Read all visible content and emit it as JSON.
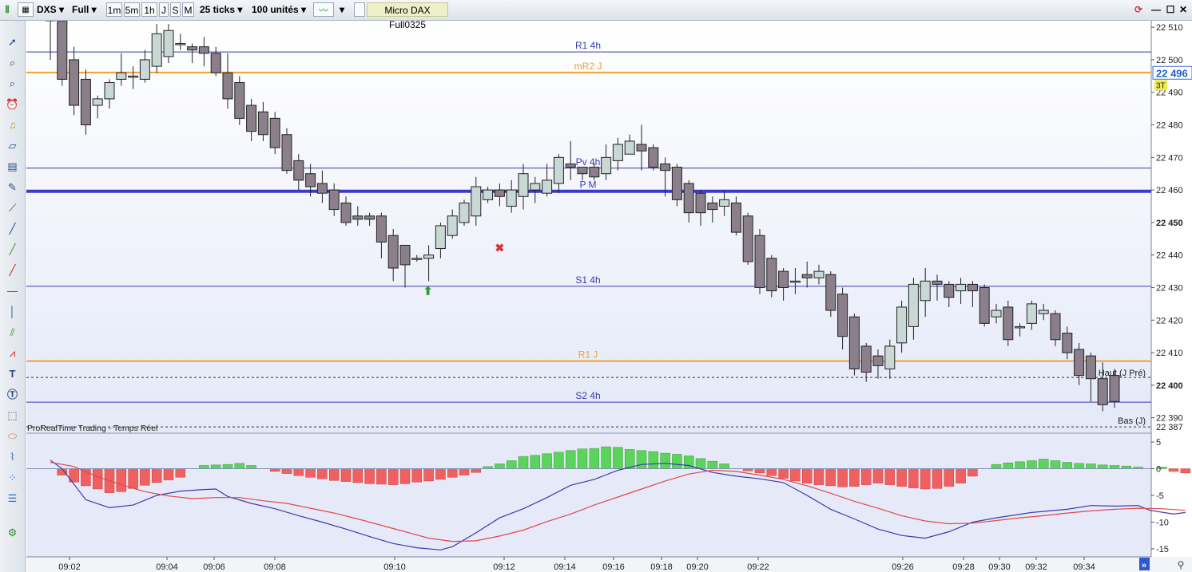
{
  "toolbar": {
    "instrument": "DXS",
    "range": "Full",
    "periods": [
      "1m",
      "5m",
      "1h",
      "J",
      "S",
      "M"
    ],
    "ticks": "25 ticks",
    "units": "100 unités",
    "contract": "Micro DAX Full0325"
  },
  "chart_title": "ProRealTime Trading - Temps Réel",
  "chart_data": [
    {
      "type": "candlestick",
      "y_ticks": [
        22510,
        22500,
        22490,
        22480,
        22470,
        22460,
        22450,
        22440,
        22430,
        22420,
        22410,
        22400,
        22390
      ],
      "ylim": [
        22385.5,
        22512
      ],
      "bold_ticks": [
        22450,
        22400
      ],
      "x_ticks": [
        "09:02",
        "09:04",
        "09:06",
        "09:08",
        "09:10",
        "09:12",
        "09:14",
        "09:16",
        "09:18",
        "09:20",
        "09:22",
        "09:26",
        "09:28",
        "09:30",
        "09:32",
        "09:34"
      ],
      "current_price": "22 496",
      "current_badge": "3T",
      "price_labels": [
        "22 387"
      ],
      "levels": [
        {
          "label": "R1 4h",
          "value": 22502.4,
          "color": "#3a3aa8",
          "width": 1
        },
        {
          "label": "mR2 J",
          "value": 22496.1,
          "color": "#f0a030",
          "width": 2
        },
        {
          "label": "Pv 4h",
          "value": 22466.7,
          "color": "#3a3aa8",
          "width": 1
        },
        {
          "label": "P M",
          "value": 22459.6,
          "color": "#3a3acc",
          "width": 4
        },
        {
          "label": "S1 4h",
          "value": 22430.4,
          "color": "#3a3aa8",
          "width": 1
        },
        {
          "label": "R1 J",
          "value": 22407.4,
          "color": "#f0a030",
          "width": 2
        },
        {
          "label": "S2 4h",
          "value": 22394.8,
          "color": "#3a3aa8",
          "width": 1
        }
      ],
      "dashed_levels": [
        {
          "label": "Haut (J Pré)",
          "value": 22402.4
        },
        {
          "label": "Bas (J)",
          "value": 22387.2
        }
      ],
      "candles": [
        [
          22515,
          22512,
          22518,
          22500
        ],
        [
          22512,
          22494,
          22515,
          22492
        ],
        [
          22500,
          22486,
          22504,
          22483
        ],
        [
          22494,
          22480,
          22497,
          22477
        ],
        [
          22486,
          22488,
          22489,
          22482
        ],
        [
          22488,
          22493,
          22494,
          22485
        ],
        [
          22494,
          22496,
          22502,
          22492
        ],
        [
          22495,
          22495,
          22498,
          22491
        ],
        [
          22494,
          22500,
          22503,
          22493
        ],
        [
          22498,
          22508,
          22511,
          22496
        ],
        [
          22501,
          22509,
          22511,
          22499
        ],
        [
          22505,
          22505,
          22508,
          22503
        ],
        [
          22504,
          22503,
          22505,
          22499
        ],
        [
          22504,
          22502,
          22507,
          22498
        ],
        [
          22502,
          22496,
          22504,
          22495
        ],
        [
          22496,
          22488,
          22502,
          22485
        ],
        [
          22493,
          22482,
          22495,
          22480
        ],
        [
          22486,
          22478,
          22488,
          22475
        ],
        [
          22484,
          22477,
          22487,
          22475
        ],
        [
          22482,
          22473,
          22484,
          22471
        ],
        [
          22477,
          22466,
          22479,
          22465
        ],
        [
          22469,
          22463,
          22471,
          22460
        ],
        [
          22465,
          22461,
          22468,
          22458
        ],
        [
          22462,
          22459,
          22466,
          22456
        ],
        [
          22460,
          22454,
          22462,
          22452
        ],
        [
          22456,
          22450,
          22458,
          22449
        ],
        [
          22452,
          22451,
          22455,
          22449
        ],
        [
          22452,
          22451,
          22453,
          22449
        ],
        [
          22452,
          22444,
          22453,
          22439
        ],
        [
          22446,
          22436,
          22448,
          22432
        ],
        [
          22443,
          22437,
          22443,
          22430
        ],
        [
          22439,
          22439,
          22440,
          22438
        ],
        [
          22439,
          22440,
          22443,
          22432
        ],
        [
          22442,
          22449,
          22450,
          22439
        ],
        [
          22446,
          22452,
          22454,
          22445
        ],
        [
          22450,
          22456,
          22457,
          22449
        ],
        [
          22452,
          22461,
          22464,
          22449
        ],
        [
          22457,
          22460,
          22461,
          22456
        ],
        [
          22460,
          22458,
          22462,
          22455
        ],
        [
          22455,
          22460,
          22463,
          22453
        ],
        [
          22458,
          22465,
          22468,
          22454
        ],
        [
          22460,
          22462,
          22464,
          22456
        ],
        [
          22459,
          22463,
          22468,
          22458
        ],
        [
          22462,
          22470,
          22471,
          22459
        ],
        [
          22468,
          22467,
          22475,
          22463
        ],
        [
          22467,
          22465,
          22466,
          22463
        ],
        [
          22467,
          22464,
          22468,
          22463
        ],
        [
          22465,
          22470,
          22474,
          22463
        ],
        [
          22469,
          22474,
          22476,
          22466
        ],
        [
          22471,
          22475,
          22477,
          22471
        ],
        [
          22474,
          22472,
          22480,
          22466
        ],
        [
          22473,
          22467,
          22474,
          22466
        ],
        [
          22468,
          22466,
          22470,
          22458
        ],
        [
          22467,
          22457,
          22468,
          22455
        ],
        [
          22462,
          22453,
          22463,
          22450
        ],
        [
          22459,
          22453,
          22460,
          22449
        ],
        [
          22456,
          22454,
          22458,
          22450
        ],
        [
          22455,
          22457,
          22460,
          22452
        ],
        [
          22456,
          22447,
          22458,
          22446
        ],
        [
          22452,
          22438,
          22453,
          22437
        ],
        [
          22446,
          22430,
          22448,
          22428
        ],
        [
          22439,
          22429,
          22440,
          22427
        ],
        [
          22435,
          22430,
          22436,
          22426
        ],
        [
          22432,
          22432,
          22436,
          22428
        ],
        [
          22434,
          22433,
          22438,
          22430
        ],
        [
          22433,
          22435,
          22437,
          22431
        ],
        [
          22434,
          22423,
          22435,
          22421
        ],
        [
          22428,
          22415,
          22430,
          22411
        ],
        [
          22421,
          22405,
          22422,
          22403
        ],
        [
          22412,
          22404,
          22413,
          22401
        ],
        [
          22409,
          22406,
          22411,
          22402
        ],
        [
          22405,
          22412,
          22414,
          22402
        ],
        [
          22413,
          22424,
          22426,
          22410
        ],
        [
          22418,
          22431,
          22433,
          22414
        ],
        [
          22426,
          22432,
          22436,
          22421
        ],
        [
          22432,
          22431,
          22434,
          22426
        ],
        [
          22431,
          22427,
          22432,
          22424
        ],
        [
          22429,
          22431,
          22433,
          22425
        ],
        [
          22431,
          22429,
          22432,
          22424
        ],
        [
          22430,
          22419,
          22431,
          22418
        ],
        [
          22421,
          22423,
          22425,
          22419
        ],
        [
          22424,
          22414,
          22426,
          22412
        ],
        [
          22418,
          22418,
          22419,
          22415
        ],
        [
          22419,
          22425,
          22426,
          22417
        ],
        [
          22422,
          22423,
          22425,
          22420
        ],
        [
          22422,
          22414,
          22423,
          22412
        ],
        [
          22416,
          22410,
          22418,
          22408
        ],
        [
          22411,
          22403,
          22413,
          22400
        ],
        [
          22409,
          22402,
          22410,
          22395
        ],
        [
          22402,
          22394,
          22407,
          22392
        ],
        [
          22403,
          22395,
          22405,
          22393
        ]
      ],
      "markers": [
        {
          "type": "buy-arrow",
          "index": 32,
          "value": 22431
        },
        {
          "type": "sell-cross",
          "index": 38,
          "value": 22442
        }
      ]
    },
    {
      "type": "histogram",
      "y_ticks": [
        5,
        0,
        -5,
        -10,
        -15
      ],
      "ylim": [
        -16.5,
        6.5
      ],
      "series": [
        {
          "type": "bar",
          "values": [
            0,
            -1.2,
            -2.5,
            -3.2,
            -3.8,
            -4.5,
            -4.3,
            -3.7,
            -3.1,
            -2.6,
            -2.1,
            -1.6,
            0,
            0.6,
            0.7,
            0.8,
            1,
            0.6,
            0,
            -0.5,
            -0.9,
            -1.3,
            -1.6,
            -1.9,
            -2.2,
            -2.4,
            -2.6,
            -2.8,
            -2.9,
            -3,
            -2.8,
            -2.5,
            -2.3,
            -2,
            -1.6,
            -1.2,
            -0.7,
            0.4,
            0.9,
            1.5,
            2.3,
            2.5,
            2.8,
            3.1,
            3.4,
            3.7,
            3.8,
            4.1,
            4,
            3.6,
            3.4,
            3.2,
            2.9,
            2.7,
            2.4,
            1.9,
            1.4,
            0.9,
            0,
            -0.4,
            -0.8,
            -1.3,
            -1.8,
            -2.3,
            -2.7,
            -3,
            -3.2,
            -3.4,
            -3.3,
            -3,
            -2.7,
            -3,
            -3.3,
            -3.6,
            -3.8,
            -3.7,
            -3.3,
            -2.7,
            -1.4,
            0,
            0.8,
            1.1,
            1.3,
            1.5,
            1.8,
            1.5,
            1.2,
            1,
            0.9,
            0.7,
            0.6,
            0.5,
            0.3,
            0,
            0.3,
            -0.5,
            -0.8,
            -0.6
          ]
        },
        {
          "type": "line",
          "color": "#3a3ab0",
          "points": [
            [
              0,
              1.6
            ],
            [
              1,
              0
            ],
            [
              3,
              -5.8
            ],
            [
              5,
              -7.3
            ],
            [
              7,
              -6.8
            ],
            [
              9,
              -5
            ],
            [
              11,
              -4.2
            ],
            [
              13,
              -3.9
            ],
            [
              14,
              -3.8
            ],
            [
              15,
              -5.2
            ],
            [
              17,
              -6.5
            ],
            [
              19,
              -7.5
            ],
            [
              21,
              -8.8
            ],
            [
              23,
              -10
            ],
            [
              25,
              -11.3
            ],
            [
              27,
              -12.7
            ],
            [
              29,
              -14
            ],
            [
              31,
              -14.8
            ],
            [
              33,
              -15.2
            ],
            [
              34,
              -14.6
            ],
            [
              36,
              -12
            ],
            [
              38,
              -9.2
            ],
            [
              40,
              -7.5
            ],
            [
              42,
              -5.4
            ],
            [
              44,
              -3.1
            ],
            [
              46,
              -2
            ],
            [
              48,
              -0.3
            ],
            [
              50,
              0.8
            ],
            [
              52,
              1
            ],
            [
              54,
              0.6
            ],
            [
              56,
              -0.7
            ],
            [
              58,
              -1.4
            ],
            [
              60,
              -1.9
            ],
            [
              62,
              -2.6
            ],
            [
              64,
              -5
            ],
            [
              66,
              -7.6
            ],
            [
              68,
              -9.4
            ],
            [
              70,
              -11.3
            ],
            [
              72,
              -12.5
            ],
            [
              74,
              -13
            ],
            [
              76,
              -11.8
            ],
            [
              78,
              -10
            ],
            [
              80,
              -9.2
            ],
            [
              83,
              -8.2
            ],
            [
              86,
              -7.6
            ],
            [
              88,
              -6.9
            ],
            [
              90,
              -7
            ],
            [
              92,
              -6.9
            ],
            [
              93,
              -7.8
            ],
            [
              95,
              -8.5
            ],
            [
              96,
              -8.2
            ]
          ]
        },
        {
          "type": "line",
          "color": "#e04848",
          "points": [
            [
              0,
              1.2
            ],
            [
              2,
              0.4
            ],
            [
              4,
              -1.5
            ],
            [
              6,
              -3
            ],
            [
              8,
              -4.3
            ],
            [
              10,
              -5.1
            ],
            [
              12,
              -5.6
            ],
            [
              14,
              -5.4
            ],
            [
              16,
              -5.4
            ],
            [
              18,
              -6
            ],
            [
              20,
              -6.5
            ],
            [
              22,
              -7.4
            ],
            [
              24,
              -8.3
            ],
            [
              26,
              -9.4
            ],
            [
              28,
              -10.6
            ],
            [
              30,
              -11.8
            ],
            [
              32,
              -13
            ],
            [
              34,
              -13.6
            ],
            [
              36,
              -13.5
            ],
            [
              38,
              -12.6
            ],
            [
              40,
              -11.5
            ],
            [
              42,
              -9.9
            ],
            [
              44,
              -8.5
            ],
            [
              46,
              -6.8
            ],
            [
              48,
              -5.3
            ],
            [
              50,
              -3.8
            ],
            [
              52,
              -2.3
            ],
            [
              54,
              -1
            ],
            [
              56,
              -0.3
            ],
            [
              58,
              -0.5
            ],
            [
              60,
              -1.2
            ],
            [
              62,
              -2
            ],
            [
              64,
              -3.2
            ],
            [
              66,
              -4.6
            ],
            [
              68,
              -6.1
            ],
            [
              70,
              -7.4
            ],
            [
              72,
              -8.8
            ],
            [
              74,
              -9.8
            ],
            [
              76,
              -10.3
            ],
            [
              78,
              -10.2
            ],
            [
              80,
              -9.7
            ],
            [
              82,
              -9.2
            ],
            [
              84,
              -8.8
            ],
            [
              86,
              -8.3
            ],
            [
              88,
              -7.9
            ],
            [
              90,
              -7.6
            ],
            [
              92,
              -7.4
            ],
            [
              94,
              -7.5
            ],
            [
              96,
              -7.8
            ]
          ]
        }
      ]
    }
  ],
  "colors": {
    "bull": "#c8d8d4",
    "bear": "#8a7f8a",
    "bg_top": "#ffffff",
    "bg_bottom": "#e4e9f8",
    "hist_pos": "#5ad45a",
    "hist_neg": "#f06060",
    "panel_bg": "#e6eaf8"
  },
  "icons": [
    "cursor-icon",
    "zoom-icon",
    "zoom-detail-icon",
    "alarm-icon",
    "bell-icon",
    "ruler-icon",
    "chart-grid-icon",
    "pencil-icon",
    "segment-icon",
    "line-icon",
    "trend-up-icon",
    "trend-down-icon",
    "h-line-icon",
    "v-line-icon",
    "channel-icon",
    "fib-icon",
    "text-icon",
    "text-circle-icon",
    "rect-icon",
    "ellipse-icon",
    "brush-icon",
    "dots-icon",
    "layers-icon",
    "settings-icon"
  ]
}
